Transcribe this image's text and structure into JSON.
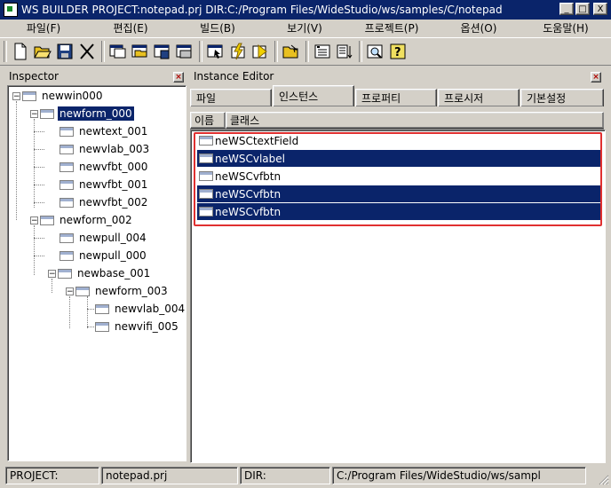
{
  "window": {
    "title": "WS BUILDER PROJECT:notepad.prj DIR:C:/Program Files/WideStudio/ws/samples/C/notepad",
    "minimize": "_",
    "maximize": "□",
    "close": "X"
  },
  "menu": [
    "파일(F)",
    "편집(E)",
    "빌드(B)",
    "보기(V)",
    "프로젝트(P)",
    "옵션(O)",
    "도움말(H)"
  ],
  "toolbar": {
    "icons": [
      "new-file-icon",
      "open-folder-icon",
      "save-icon",
      "cut-icon",
      "new-window-icon",
      "open-window-icon",
      "save-window-icon",
      "delete-window-icon",
      "select-tool-icon",
      "build-icon",
      "run-icon",
      "open-project-icon",
      "properties-icon",
      "align-icon",
      "find-icon",
      "help-icon"
    ]
  },
  "inspector": {
    "title": "Inspector",
    "close": "×",
    "tree": [
      {
        "label": "newwin000",
        "level": 0,
        "expander": "−"
      },
      {
        "label": "newform_000",
        "level": 1,
        "expander": "−",
        "selected": true
      },
      {
        "label": "newtext_001",
        "level": 2
      },
      {
        "label": "newvlab_003",
        "level": 2
      },
      {
        "label": "newvfbt_000",
        "level": 2
      },
      {
        "label": "newvfbt_001",
        "level": 2
      },
      {
        "label": "newvfbt_002",
        "level": 2
      },
      {
        "label": "newform_002",
        "level": 1,
        "expander": "−"
      },
      {
        "label": "newpull_004",
        "level": 2
      },
      {
        "label": "newpull_000",
        "level": 2
      },
      {
        "label": "newbase_001",
        "level": 2,
        "expander": "−"
      },
      {
        "label": "newform_003",
        "level": 3,
        "expander": "−"
      },
      {
        "label": "newvlab_004",
        "level": 4
      },
      {
        "label": "newvifi_005",
        "level": 4
      }
    ]
  },
  "instance_editor": {
    "title": "Instance Editor",
    "close": "×",
    "tabs": [
      "파일",
      "인스턴스",
      "프로퍼티",
      "프로시저",
      "기본설정"
    ],
    "columns": [
      "이름",
      "클래스"
    ],
    "rows": [
      {
        "label": "neWSCtextField",
        "selected": false
      },
      {
        "label": "neWSCvlabel",
        "selected": true
      },
      {
        "label": "neWSCvfbtn",
        "selected": false
      },
      {
        "label": "neWSCvfbtn",
        "selected": true
      },
      {
        "label": "neWSCvfbtn",
        "selected": true
      }
    ]
  },
  "status": {
    "project_label": "PROJECT:",
    "project_value": "notepad.prj",
    "dir_label": "DIR:",
    "dir_value": "C:/Program Files/WideStudio/ws/sampl"
  }
}
